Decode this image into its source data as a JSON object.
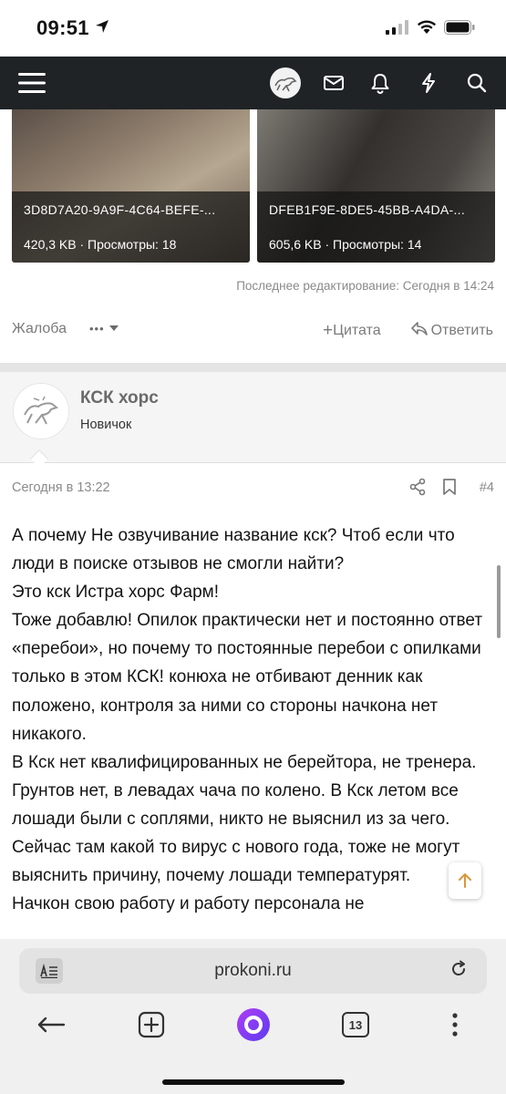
{
  "status_bar": {
    "time": "09:51"
  },
  "attachments": [
    {
      "name": "3D8D7A20-9A9F-4C64-BEFE-...",
      "meta": "420,3 KB · Просмотры: 18"
    },
    {
      "name": "DFEB1F9E-8DE5-45BB-A4DA-...",
      "meta": "605,6 KB · Просмотры: 14"
    }
  ],
  "prev_post": {
    "edit_note": "Последнее редактирование: Сегодня в 14:24",
    "report_label": "Жалоба",
    "more_label": "•••",
    "quote_label": "Цитата",
    "reply_label": "Ответить"
  },
  "post": {
    "author_name": "КСК хорс",
    "author_title": "Новичок",
    "date": "Сегодня в 13:22",
    "number": "#4",
    "paragraphs": [
      "А почему Не озвучивание название кск? Чтоб если что люди в поиске отзывов не смогли найти?",
      "Это кск Истра хорс Фарм!",
      "Тоже добавлю! Опилок практически нет и постоянно ответ «перебои», но почему то постоянные перебои с опилками только в этом КСК! конюха не отбивают денник как положено, контроля за ними со стороны начкона нет никакого.",
      "В Кск нет квалифицированных не берейтора, не тренера. Грунтов нет, в левадах чача по колено. В Кск летом все лошади были с соплями, никто не выяснил из за чего. Сейчас там какой то вирус с нового года, тоже не могут выяснить причину, почему лошади температурят.",
      "Начкон свою работу и работу персонала не"
    ]
  },
  "browser": {
    "url": "prokoni.ru",
    "tabs_count": "13"
  },
  "colors": {
    "nav_bg": "#1f2326",
    "alice_purple": "#8a3cf0"
  }
}
